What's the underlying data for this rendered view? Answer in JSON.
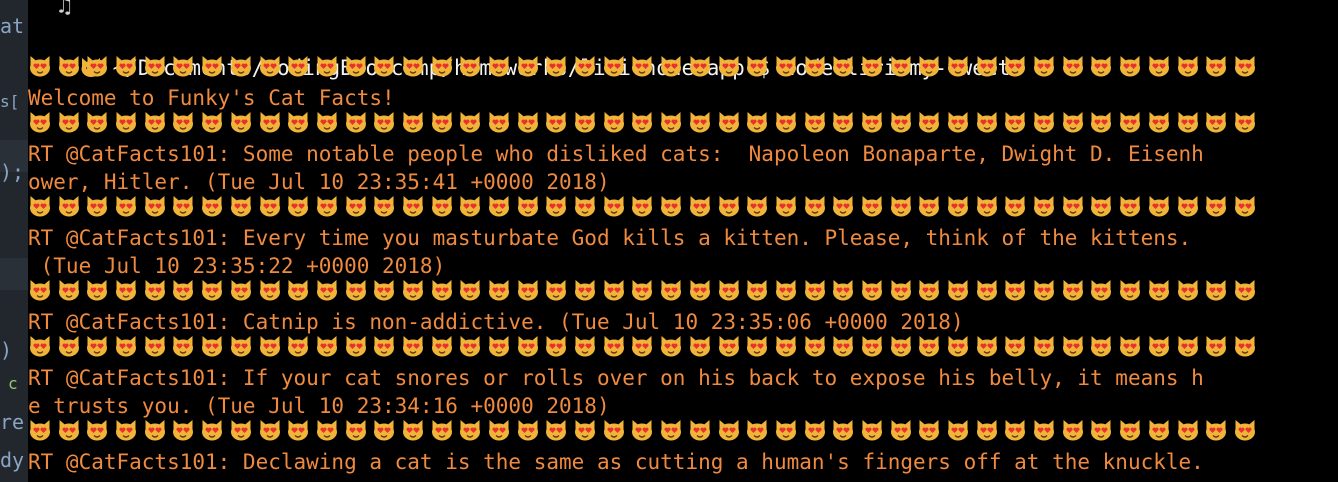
{
  "editor_left": {
    "fragments": [
      "at",
      "s[",
      ");",
      ")",
      "c",
      "re",
      "dy"
    ]
  },
  "editor_right": {
    "bracket": "]"
  },
  "terminal": {
    "music_glyph": "♫",
    "prompt_path": "~/Documents/codingBootcamp/homeworks/liri-node-app $ node liri my-tweets",
    "welcome": "Welcome to Funky's Cat Facts!",
    "tweets": [
      {
        "line1": "RT @CatFacts101: Some notable people who disliked cats:  Napoleon Bonaparte, Dwight D. Eisenh",
        "line2": "ower, Hitler. (Tue Jul 10 23:35:41 +0000 2018)"
      },
      {
        "line1": "RT @CatFacts101: Every time you masturbate God kills a kitten. Please, think of the kittens.",
        "line2": " (Tue Jul 10 23:35:22 +0000 2018)"
      },
      {
        "line1": "RT @CatFacts101: Catnip is non-addictive. (Tue Jul 10 23:35:06 +0000 2018)"
      },
      {
        "line1": "RT @CatFacts101: If your cat snores or rolls over on his back to expose his belly, it means h",
        "line2": "e trusts you. (Tue Jul 10 23:34:16 +0000 2018)"
      },
      {
        "line1": "RT @CatFacts101: Declawing a cat is the same as cutting a human's fingers off at the knuckle."
      }
    ],
    "emoji_name": "heart-eyes-cat-icon",
    "emoji_per_row": 43
  },
  "colors": {
    "output_text": "#ef8a3f",
    "prompt_text": "#f2f2f2",
    "background": "#000000",
    "emoji_face": "#f0b43a",
    "emoji_heart": "#e8332b"
  }
}
